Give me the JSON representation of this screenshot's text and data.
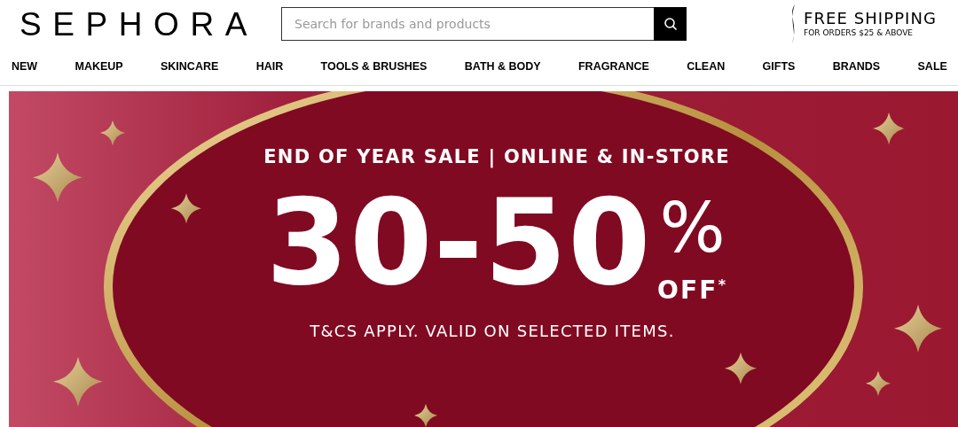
{
  "header": {
    "logo": "SEPHORA",
    "search": {
      "placeholder": "Search for brands and products"
    },
    "shipping": {
      "title": "FREE SHIPPING",
      "subtitle": "FOR ORDERS $25 & ABOVE"
    }
  },
  "nav": [
    {
      "label": "NEW"
    },
    {
      "label": "MAKEUP"
    },
    {
      "label": "SKINCARE"
    },
    {
      "label": "HAIR"
    },
    {
      "label": "TOOLS & BRUSHES"
    },
    {
      "label": "BATH & BODY"
    },
    {
      "label": "FRAGRANCE"
    },
    {
      "label": "CLEAN"
    },
    {
      "label": "GIFTS"
    },
    {
      "label": "BRANDS"
    },
    {
      "label": "SALE"
    }
  ],
  "banner": {
    "headline": "END OF YEAR SALE | ONLINE & IN-STORE",
    "discount": "30-50",
    "percent": "%",
    "off": "OFF$^{*}$",
    "terms": "T&CS APPLY. VALID ON SELECTED ITEMS."
  }
}
